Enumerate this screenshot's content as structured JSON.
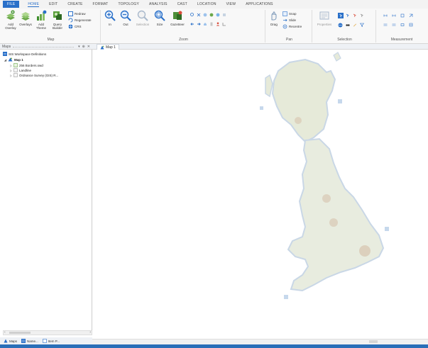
{
  "menu": {
    "items": [
      "FILE",
      "HOME",
      "EDIT",
      "CREATE",
      "FORMAT",
      "TOPOLOGY",
      "ANALYSIS",
      "CAST",
      "LOCATION",
      "VIEW",
      "APPLICATIONS"
    ],
    "active": "HOME"
  },
  "ribbon": {
    "map_group": {
      "label": "Map",
      "add_overlay": "Add Overlay",
      "overlays": "Overlays",
      "add_theme": "Add Theme",
      "query_builder": "Query Builder",
      "redraw": "Redraw",
      "regenerate": "Regenerate",
      "crs": "CRS"
    },
    "zoom_group": {
      "label": "Zoom",
      "in": "In",
      "out": "Out",
      "selection": "Selection",
      "size": "Size",
      "gazetteer": "Gazetteer"
    },
    "pan_group": {
      "label": "Pan",
      "drag": "Drag",
      "snap": "Snap",
      "slide": "Slide",
      "recentre": "Recentre"
    },
    "selection_group": {
      "label": "Selection",
      "properties": "Properties"
    },
    "measurement_group": {
      "label": "Measurement"
    }
  },
  "maps_panel": {
    "title": "Maps",
    "controls": [
      "▾",
      "⊕",
      "✕"
    ],
    "tree": {
      "root": "SIS Workspace Definitions",
      "map": "Map 1",
      "children": [
        "256 Borders.swd",
        "Landline",
        "Ordnance Survey (GIS) R..."
      ]
    },
    "tabs": [
      "Maps",
      "Name...",
      "Item P..."
    ]
  },
  "document": {
    "tab": "Map 1"
  },
  "colors": {
    "accent": "#2a70c9",
    "statusbar": "#2a6fb8",
    "map_land": "#e8ecdf",
    "map_water": "#c6d8ec",
    "map_urban": "#d8c9b4"
  }
}
